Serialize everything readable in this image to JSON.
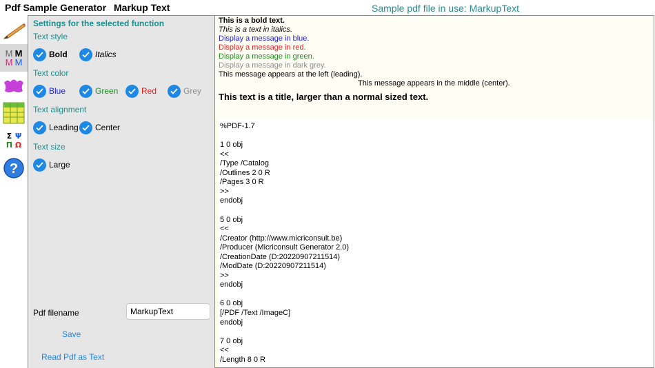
{
  "header": {
    "app_title": "Pdf Sample Generator",
    "function_title": "Markup Text",
    "file_in_use": "Sample pdf file in use: MarkupText"
  },
  "toolbar": {
    "tools": [
      {
        "icon": "pencil-icon",
        "selected": false
      },
      {
        "icon": "markup-text-icon",
        "selected": true,
        "glyphs": [
          "M",
          "M",
          "M",
          "M"
        ]
      },
      {
        "icon": "drawing-icon",
        "selected": false
      },
      {
        "icon": "table-icon",
        "selected": false
      },
      {
        "icon": "symbols-icon",
        "selected": false,
        "glyphs": [
          "Σ",
          "Ψ",
          "Π",
          "Ω"
        ]
      },
      {
        "icon": "help-icon",
        "selected": false,
        "glyph": "?"
      }
    ]
  },
  "settings": {
    "header": "Settings for the selected function",
    "text_style": {
      "label": "Text style",
      "bold": "Bold",
      "italics": "Italics"
    },
    "text_color": {
      "label": "Text color",
      "blue": "Blue",
      "green": "Green",
      "red": "Red",
      "grey": "Grey"
    },
    "text_alignment": {
      "label": "Text alignment",
      "leading": "Leading",
      "center": "Center"
    },
    "text_size": {
      "label": "Text size",
      "large": "Large"
    },
    "filename_label": "Pdf filename",
    "filename_value": "MarkupText",
    "save_label": "Save",
    "read_pdf_label": "Read Pdf as Text"
  },
  "preview": {
    "lines": [
      "This is a bold text.",
      "This is a text in italics.",
      "Display a message in blue.",
      "Display a message in red.",
      "Display a message in green.",
      "Display a message in dark grey.",
      "This message appears at the left (leading).",
      "This message appears in the middle (center).",
      "This text is a title, larger than a normal sized text."
    ],
    "source_lines": [
      "%PDF-1.7",
      "",
      "1 0 obj",
      "<<",
      "/Type /Catalog",
      "/Outlines 2 0 R",
      "/Pages 3 0 R",
      ">>",
      "endobj",
      "",
      "5 0 obj",
      "<<",
      "/Creator (http://www.micriconsult.be)",
      "/Producer (Micriconsult Generator 2.0)",
      "/CreationDate (D:20220907211514)",
      "/ModDate (D:20220907211514)",
      ">>",
      "endobj",
      "",
      "6 0 obj",
      "[/PDF /Text /ImageC]",
      "endobj",
      "",
      "7 0 obj",
      "<<",
      "/Length 8 0 R"
    ]
  },
  "colors": {
    "accent_teal": "#1a8f8f",
    "check_blue": "#1e88e5",
    "text_blue": "#1a1ae6",
    "text_green": "#1e8c1e",
    "text_red": "#e61e1e",
    "text_grey": "#8c8c8c"
  }
}
